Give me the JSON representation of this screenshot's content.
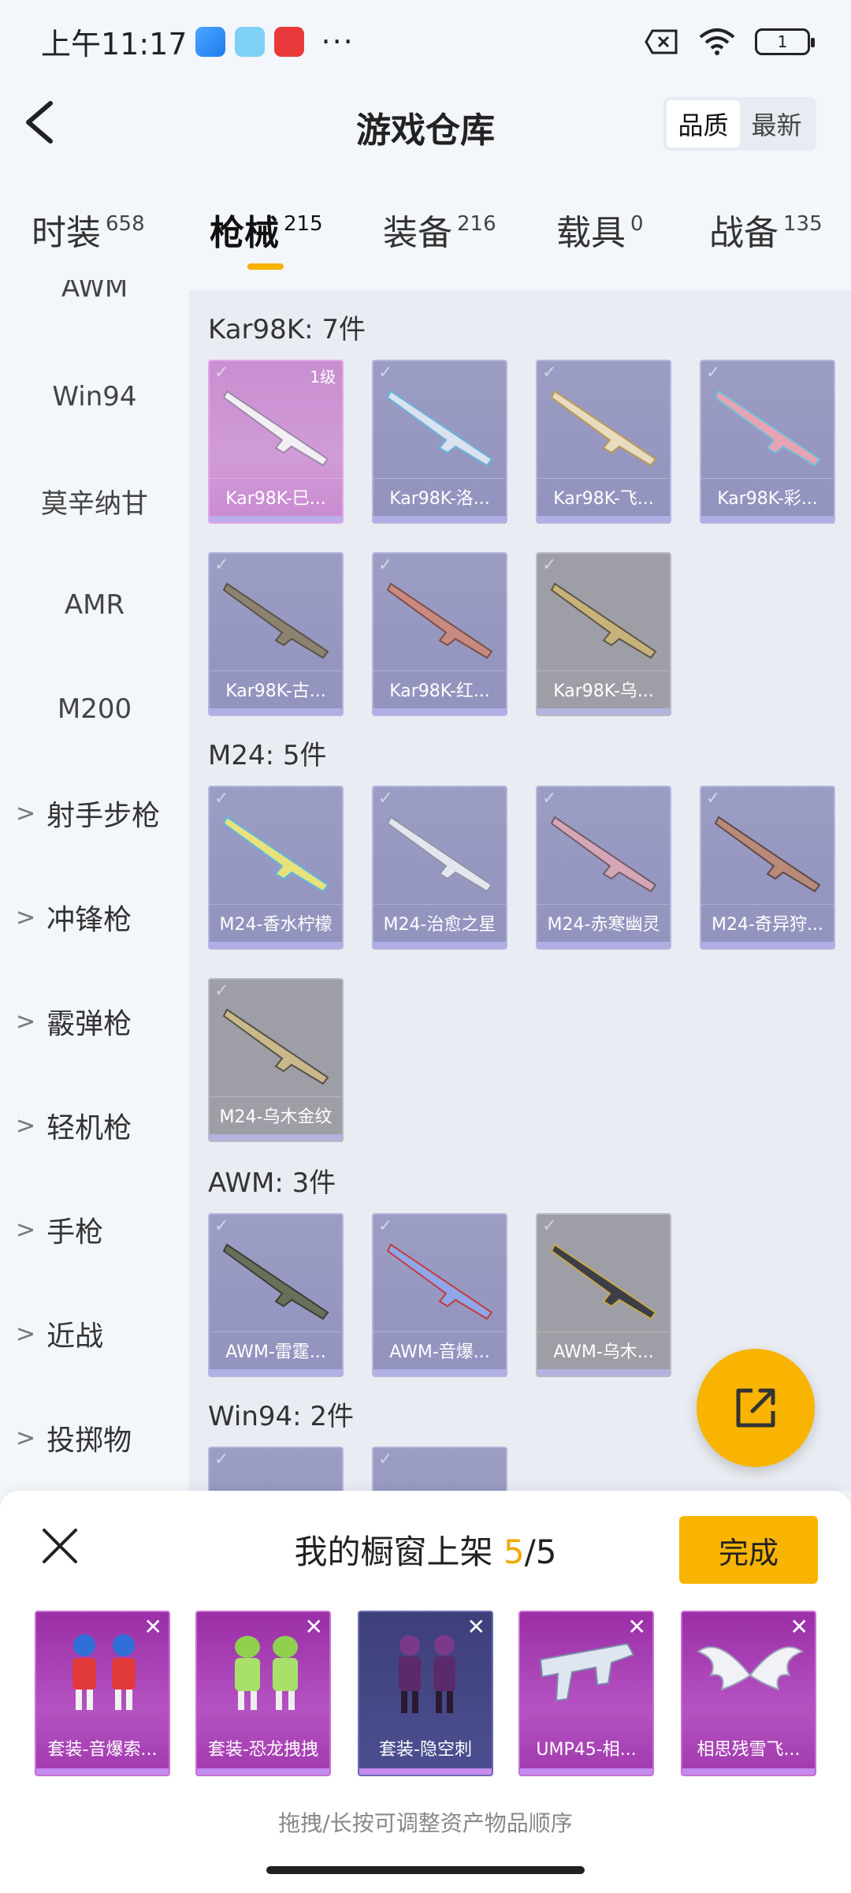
{
  "status_bar": {
    "time": "上午11:17",
    "overflow": "···",
    "battery": "1",
    "icons": [
      "app-icon-blue",
      "app-icon-light-blue",
      "app-icon-red",
      "sim-off-icon",
      "wifi-icon",
      "battery-icon"
    ]
  },
  "header": {
    "title": "游戏仓库",
    "sort_options": [
      "品质",
      "最新"
    ],
    "sort_selected": "品质"
  },
  "tabs": [
    {
      "label": "时装",
      "count": "658"
    },
    {
      "label": "枪械",
      "count": "215",
      "active": true
    },
    {
      "label": "装备",
      "count": "216"
    },
    {
      "label": "载具",
      "count": "0"
    },
    {
      "label": "战备",
      "count": "135"
    }
  ],
  "subnav": {
    "items": [
      "AWM",
      "Win94",
      "莫辛纳甘",
      "AMR",
      "M200"
    ],
    "groups": [
      "射手步枪",
      "冲锋枪",
      "霰弹枪",
      "轻机枪",
      "手枪",
      "近战",
      "投掷物"
    ]
  },
  "sections": [
    {
      "title": "Kar98K: 7件",
      "items": [
        {
          "name": "Kar98K-巳...",
          "level": "1级",
          "style": "pink"
        },
        {
          "name": "Kar98K-洛...",
          "style": "purple"
        },
        {
          "name": "Kar98K-飞...",
          "style": "purple"
        },
        {
          "name": "Kar98K-彩...",
          "style": "purple"
        },
        {
          "name": "Kar98K-古...",
          "style": "purple"
        },
        {
          "name": "Kar98K-红...",
          "style": "purple"
        },
        {
          "name": "Kar98K-乌...",
          "style": "gray"
        }
      ]
    },
    {
      "title": "M24: 5件",
      "items": [
        {
          "name": "M24-香水柠檬",
          "style": "purple"
        },
        {
          "name": "M24-治愈之星",
          "style": "purple"
        },
        {
          "name": "M24-赤寒幽灵",
          "style": "purple"
        },
        {
          "name": "M24-奇异狩...",
          "style": "purple"
        },
        {
          "name": "M24-乌木金纹",
          "style": "gray"
        }
      ]
    },
    {
      "title": "AWM: 3件",
      "items": [
        {
          "name": "AWM-雷霆...",
          "style": "purple"
        },
        {
          "name": "AWM-音爆...",
          "style": "purple"
        },
        {
          "name": "AWM-乌木...",
          "style": "gray"
        }
      ]
    },
    {
      "title": "Win94: 2件",
      "items": [
        {
          "name": "",
          "style": "purple"
        },
        {
          "name": "",
          "style": "purple"
        }
      ]
    }
  ],
  "sheet": {
    "title_prefix": "我的橱窗上架",
    "count_current": "5",
    "count_total": "/5",
    "done_label": "完成",
    "hint": "拖拽/长按可调整资产物品顺序",
    "items": [
      {
        "name": "套装-音爆索...",
        "style": "purple"
      },
      {
        "name": "套装-恐龙拽拽",
        "style": "purple"
      },
      {
        "name": "套装-隐空刺",
        "style": "dark"
      },
      {
        "name": "UMP45-相...",
        "style": "purple"
      },
      {
        "name": "相思残雪飞...",
        "style": "purple"
      }
    ]
  },
  "colors": {
    "accent": "#f8b400",
    "background": "#f3f6fb",
    "content_bg": "#e9ecf2"
  }
}
